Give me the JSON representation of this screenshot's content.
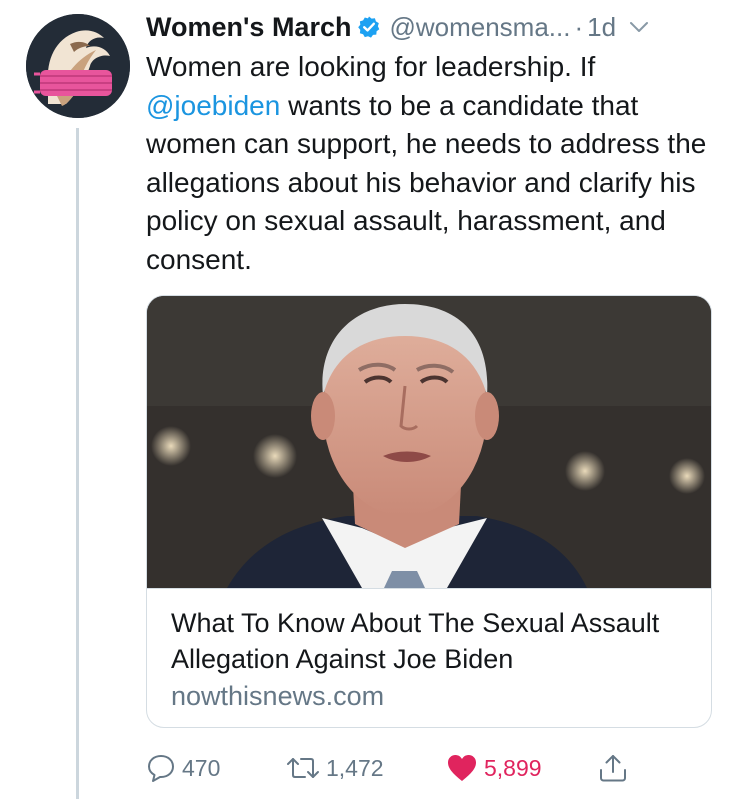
{
  "tweet": {
    "author_name": "Women's March",
    "handle": "@womensma...",
    "separator": "·",
    "time": "1d",
    "text_before_mention": "Women are looking for leadership. If",
    "mention": "@joebiden",
    "text_after_mention": "wants to be a candidate that women can support, he needs to address the allegations about his behavior and clarify his policy on sexual assault, harassment, and consent."
  },
  "card": {
    "title": "What To Know About The Sexual Assault Allegation Against Joe Biden",
    "domain": "nowthisnews.com"
  },
  "actions": {
    "replies": "470",
    "retweets": "1,472",
    "likes": "5,899"
  },
  "colors": {
    "link": "#1b95e0",
    "secondary_text": "#657786",
    "like": "#e0245e",
    "verified": "#1da1f2",
    "border": "#d5dde3"
  },
  "icons": [
    "verified-badge-icon",
    "chevron-down-icon",
    "reply-icon",
    "retweet-icon",
    "heart-icon",
    "share-icon"
  ]
}
